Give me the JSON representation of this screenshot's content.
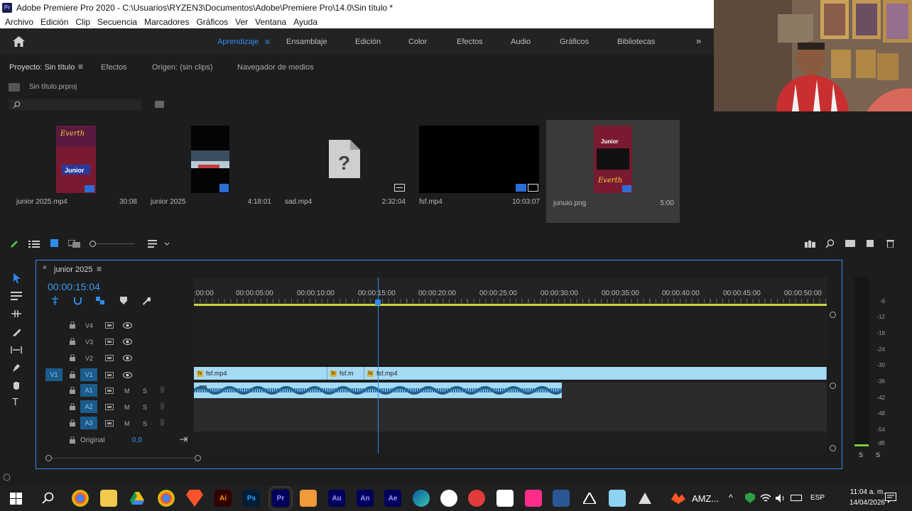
{
  "window": {
    "title": "Adobe Premiere Pro 2020 - C:\\Usuarios\\RYZEN3\\Documentos\\Adobe\\Premiere Pro\\14.0\\Sin título *",
    "app_badge": "Pr"
  },
  "menu": [
    "Archivo",
    "Edición",
    "Clip",
    "Secuencia",
    "Marcadores",
    "Gráficos",
    "Ver",
    "Ventana",
    "Ayuda"
  ],
  "workspaces": [
    "Aprendizaje",
    "Ensamblaje",
    "Edición",
    "Color",
    "Efectos",
    "Audio",
    "Gráficos",
    "Bibliotecas"
  ],
  "workspaces_active": "Aprendizaje",
  "panel_tabs": {
    "project": "Proyecto: Sin título",
    "effects": "Efectos",
    "source": "Origen: (sin clips)",
    "browser": "Navegador de medios"
  },
  "project_file": "Sin título.prproj",
  "clips": [
    {
      "name": "junior 2025.mp4",
      "duration": "30:08"
    },
    {
      "name": "junior 2025",
      "duration": "4:18:01"
    },
    {
      "name": "sad.mp4",
      "duration": "2:32:04"
    },
    {
      "name": "fsf.mp4",
      "duration": "10:03:07"
    },
    {
      "name": "junuio.png",
      "duration": "5:00"
    }
  ],
  "poster_text": {
    "line1": "Everth",
    "line2": "Junior",
    "line3": "Everth"
  },
  "sequence": {
    "name": "junior 2025",
    "timecode": "00:00:15:04",
    "ruler_labels": [
      ":00:00",
      "00:00:05:00",
      "00:00:10:00",
      "00:00:15:00",
      "00:00:20:00",
      "00:00:25:00",
      "00:00:30:00",
      "00:00:35:00",
      "00:00:40:00",
      "00:00:45:00",
      "00:00:50:00"
    ],
    "video_tracks": [
      "V4",
      "V3",
      "V2",
      "V1"
    ],
    "audio_tracks": [
      "A1",
      "A2",
      "A3"
    ],
    "source_v1": "V1",
    "mute": "M",
    "solo": "S",
    "master_label": "Original",
    "master_value": "0,0",
    "clips_v1": [
      {
        "label": "fsf.mp4"
      },
      {
        "label": "fsf.m"
      },
      {
        "label": "fsf.mp4"
      }
    ]
  },
  "meter_labels": [
    "-6",
    "-12",
    "-18",
    "-24",
    "-30",
    "-36",
    "-42",
    "-48",
    "-54",
    "dB"
  ],
  "meter_solo": [
    "S",
    "S"
  ],
  "taskbar": {
    "time": "11:04 a. m.",
    "date": "14/04/2026",
    "lang": "ESP",
    "amz": "AMZ...",
    "icons": [
      {
        "label": "Ai",
        "color": "#330000",
        "text_color": "#ff9a00"
      },
      {
        "label": "Ps",
        "color": "#001e36",
        "text_color": "#31a8ff"
      },
      {
        "label": "Pr",
        "color": "#00005b",
        "text_color": "#9999ff"
      },
      {
        "label": "Au",
        "color": "#00005b",
        "text_color": "#9999ff"
      },
      {
        "label": "An",
        "color": "#00005b",
        "text_color": "#9999ff"
      },
      {
        "label": "Ae",
        "color": "#00005b",
        "text_color": "#9999ff"
      }
    ]
  }
}
